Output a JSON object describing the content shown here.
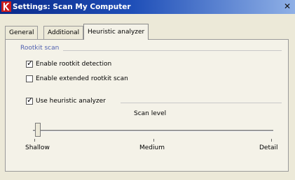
{
  "window": {
    "title": "Settings: Scan My Computer",
    "close_symbol": "✕"
  },
  "tabs": [
    {
      "label": "General",
      "active": false
    },
    {
      "label": "Additional",
      "active": false
    },
    {
      "label": "Heuristic analyzer",
      "active": true
    }
  ],
  "rootkit_group": {
    "legend": "Rootkit scan",
    "options": [
      {
        "label": "Enable rootkit detection",
        "checked": true
      },
      {
        "label": "Enable extended rootkit scan",
        "checked": false
      }
    ]
  },
  "heuristic": {
    "label": "Use heuristic analyzer",
    "checked": true,
    "scan_level_label": "Scan level",
    "slider": {
      "value": 0,
      "ticks": [
        "Shallow",
        "Medium",
        "Detail"
      ],
      "selected": "Shallow"
    }
  },
  "icons": {
    "app": "kaspersky-k-icon",
    "check": "checkmark-icon"
  },
  "colors": {
    "title_bar": "#1f4fb8",
    "group_legend": "#5060b0",
    "app_icon": "#cc1c1c"
  }
}
